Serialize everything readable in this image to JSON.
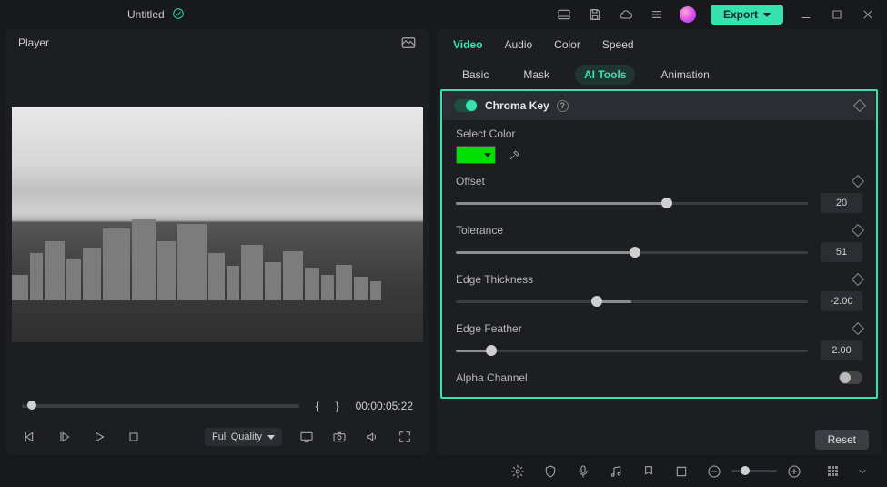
{
  "header": {
    "title": "Untitled",
    "export_label": "Export"
  },
  "player": {
    "panel_title": "Player",
    "timecode": "00:00:05:22",
    "quality_label": "Full Quality"
  },
  "right": {
    "tabs1": {
      "video": "Video",
      "audio": "Audio",
      "color": "Color",
      "speed": "Speed"
    },
    "tabs2": {
      "basic": "Basic",
      "mask": "Mask",
      "aitools": "AI Tools",
      "animation": "Animation"
    },
    "chroma": {
      "title": "Chroma Key",
      "select_color_label": "Select Color",
      "color_value": "#00e000",
      "offset": {
        "label": "Offset",
        "value": "20",
        "pct": 60
      },
      "tolerance": {
        "label": "Tolerance",
        "value": "51",
        "pct": 51
      },
      "edge_thickness": {
        "label": "Edge Thickness",
        "value": "-2.00",
        "pct": 40
      },
      "edge_feather": {
        "label": "Edge Feather",
        "value": "2.00",
        "pct": 10
      },
      "alpha_label": "Alpha Channel"
    },
    "reset_label": "Reset"
  }
}
